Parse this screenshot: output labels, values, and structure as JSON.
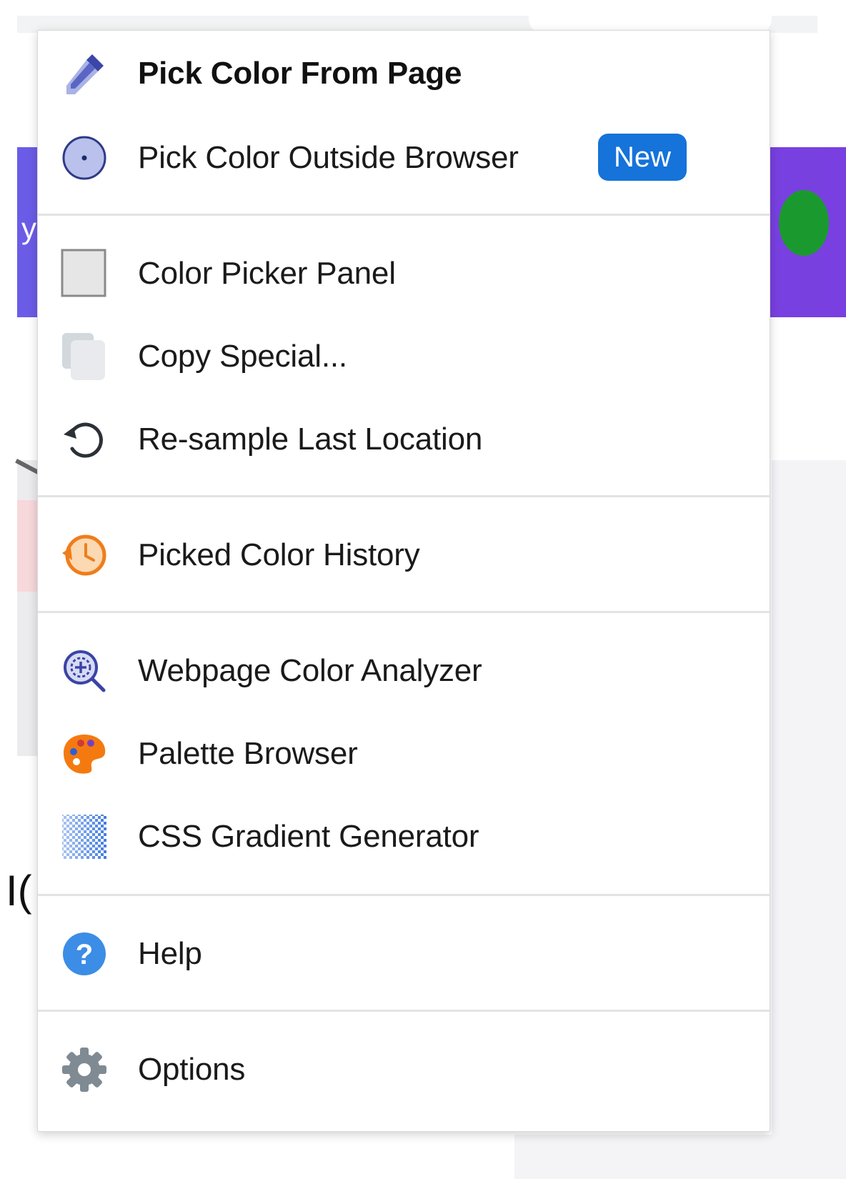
{
  "menu": {
    "items": [
      {
        "label": "Pick Color From Page",
        "icon": "eyedropper-icon",
        "bold": true
      },
      {
        "label": "Pick Color Outside Browser",
        "icon": "target-circle-icon",
        "badge": "New"
      },
      {
        "label": "Color Picker Panel",
        "icon": "color-swatch-icon"
      },
      {
        "label": "Copy Special...",
        "icon": "copy-icon"
      },
      {
        "label": "Re-sample Last Location",
        "icon": "refresh-icon"
      },
      {
        "label": "Picked Color History",
        "icon": "history-clock-icon"
      },
      {
        "label": "Webpage Color Analyzer",
        "icon": "magnifier-icon"
      },
      {
        "label": "Palette Browser",
        "icon": "palette-icon"
      },
      {
        "label": "CSS Gradient Generator",
        "icon": "gradient-icon"
      },
      {
        "label": "Help",
        "icon": "help-icon"
      },
      {
        "label": "Options",
        "icon": "gear-icon"
      }
    ]
  },
  "colors": {
    "badge": "#1573d9",
    "eyedropper": "#4a55b5",
    "history": "#f07d1a",
    "help": "#3b8de6",
    "gear": "#7f8a93",
    "palette": "#f47a10"
  }
}
